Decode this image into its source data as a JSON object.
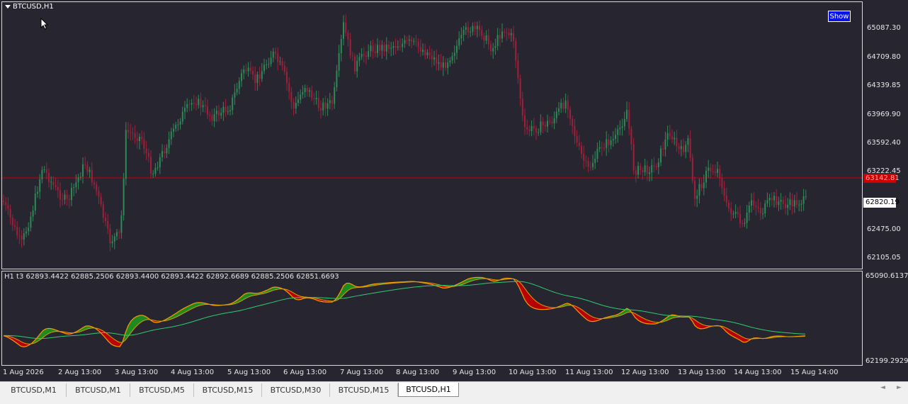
{
  "chart": {
    "title": "BTCUSD,H1",
    "show_button": "Show",
    "price_axis": [
      "65087.30",
      "64709.80",
      "64339.85",
      "63969.90",
      "63592.40",
      "63222.45",
      "62475.00",
      "62105.05"
    ],
    "bid_price": "63142.81",
    "current_price": "62820.19",
    "time_axis": [
      "1 Aug 2026",
      "2 Aug 13:00",
      "3 Aug 13:00",
      "4 Aug 13:00",
      "5 Aug 13:00",
      "6 Aug 13:00",
      "7 Aug 13:00",
      "8 Aug 13:00",
      "9 Aug 13:00",
      "10 Aug 13:00",
      "11 Aug 13:00",
      "12 Aug 13:00",
      "13 Aug 13:00",
      "14 Aug 13:00",
      "15 Aug 14:00"
    ],
    "colors": {
      "background": "#272530",
      "bull_candle": "#2e8b57",
      "bear_candle": "#a0203c",
      "bid_line": "#d00000"
    }
  },
  "indicator": {
    "title": "H1 t3  62893.4422 62885.2506 62893.4400 62893.4422 62892.6689 62885.2506 62851.6693",
    "axis_max": "65090.6137",
    "axis_min": "62199.2929",
    "colors": {
      "up_fill": "#1f8a1f",
      "down_fill": "#b80000",
      "line_orange": "#ff9900",
      "line_green": "#2ecc71"
    }
  },
  "tabs": [
    "BTCUSD,M1",
    "BTCUSD,M1",
    "BTCUSD,M5",
    "BTCUSD,M15",
    "BTCUSD,M30",
    "BTCUSD,M15",
    "BTCUSD,H1"
  ],
  "active_tab": "BTCUSD,H1",
  "nav_arrows": {
    "left": "◄",
    "right": "►"
  }
}
